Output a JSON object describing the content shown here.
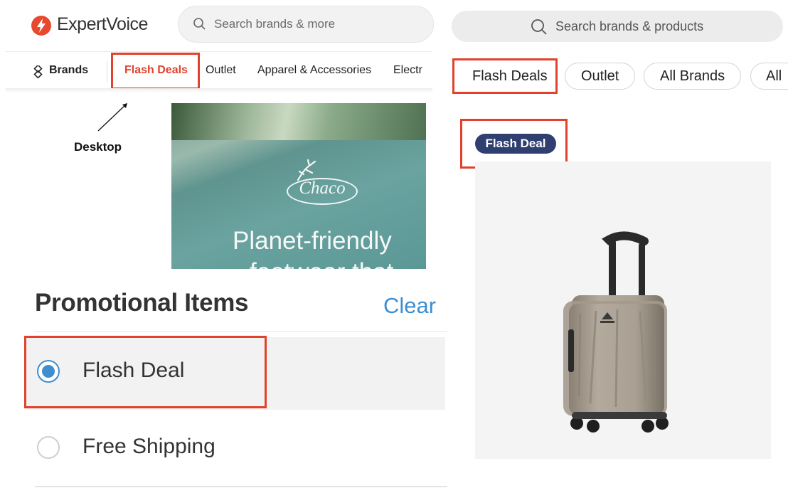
{
  "desktop": {
    "brand": {
      "name": "ExpertVoice",
      "icon": "bolt-icon",
      "color": "#e6492e"
    },
    "search_placeholder": "Search brands & more",
    "nav": {
      "brands": "Brands",
      "items": [
        "Flash Deals",
        "Outlet",
        "Apparel & Accessories",
        "Electr"
      ]
    },
    "annotation_label": "Desktop",
    "promo": {
      "brand": "Chaco",
      "headline": "Planet-friendly",
      "subline": "footwear that"
    },
    "filters": {
      "title": "Promotional Items",
      "clear": "Clear",
      "options": [
        {
          "label": "Flash Deal",
          "selected": true
        },
        {
          "label": "Free Shipping",
          "selected": false
        }
      ]
    }
  },
  "mobile": {
    "search_placeholder": "Search brands & products",
    "chips": [
      "Flash Deals",
      "Outlet",
      "All Brands",
      "All"
    ],
    "badge": "Flash Deal",
    "product_image": "carry-on-suitcase"
  },
  "colors": {
    "highlight": "#e0422b",
    "accent": "#3e8ed0",
    "badge": "#2f3f70"
  }
}
